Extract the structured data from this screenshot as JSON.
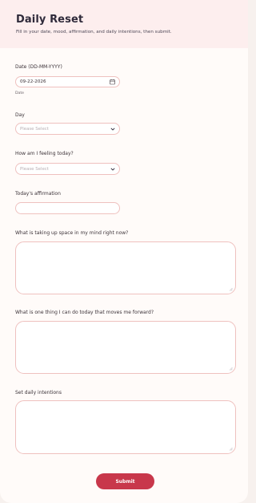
{
  "header": {
    "title": "Daily Reset",
    "subtitle": "Fill in your date, mood, affirmation, and daily intentions, then submit."
  },
  "date": {
    "label": "Date (DD-MM-YYYY)",
    "value": "09-22-2026",
    "sublabel": "Date",
    "icon": "calendar-icon"
  },
  "day": {
    "label": "Day",
    "placeholder": "Please Select",
    "icon": "chevron-down-icon"
  },
  "mood": {
    "label": "How am I feeling today?",
    "placeholder": "Please Select",
    "icon": "chevron-down-icon"
  },
  "affirmation": {
    "label": "Today's affirmation",
    "value": ""
  },
  "mind": {
    "label": "What is taking up space in my mind right now?",
    "value": ""
  },
  "forward": {
    "label": "What is one thing I can do today that moves me forward?",
    "value": ""
  },
  "intentions": {
    "label": "Set daily intentions",
    "value": ""
  },
  "submit_label": "Submit",
  "colors": {
    "accent": "#c8374b",
    "header_bg": "#fdeeee",
    "field_border": "#efc1bf"
  }
}
